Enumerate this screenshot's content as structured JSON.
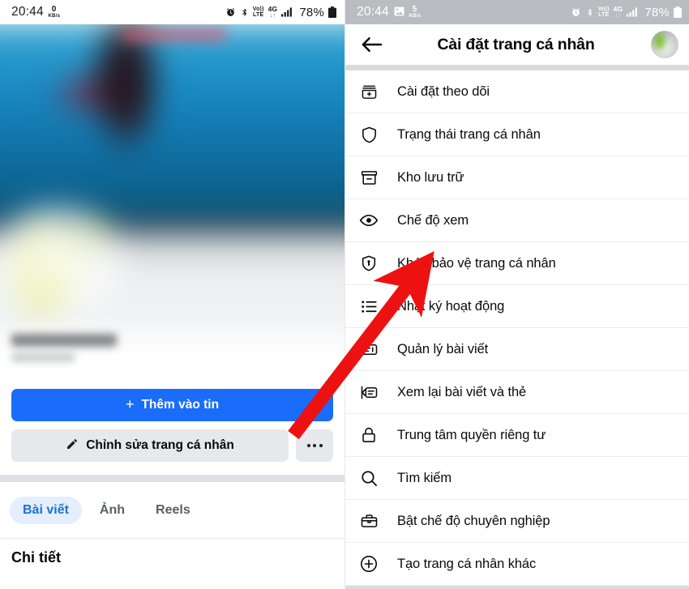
{
  "left_panel": {
    "statusbar": {
      "time": "20:44",
      "net_speed": "0",
      "net_unit": "KB/s",
      "alarm_icon": "alarm-icon",
      "bluetooth_icon": "bluetooth-icon",
      "volte_top": "Vo))",
      "volte_bottom": "LTE",
      "network_type": "4G",
      "network_arrows": "↓↑",
      "signal_icon": "signal-bars-icon",
      "battery": "78%",
      "battery_icon": "battery-icon"
    },
    "story_button": {
      "label": "Thêm vào tin",
      "plus": "+",
      "color": "#1a6dfa"
    },
    "edit_profile_button": {
      "label": "Chỉnh sửa trang cá nhân",
      "icon": "pencil-icon",
      "color": "#e6e8ec"
    },
    "more_button": {
      "icon": "ellipsis-icon"
    },
    "tabs": [
      {
        "label": "Bài viết",
        "active": true
      },
      {
        "label": "Ảnh",
        "active": false
      },
      {
        "label": "Reels",
        "active": false
      }
    ],
    "detail_heading": "Chi tiết",
    "active_tab_color": "#1a73d4"
  },
  "right_panel": {
    "statusbar": {
      "time": "20:44",
      "image_icon": "image-icon",
      "net_speed": "5",
      "net_unit": "KB/s",
      "alarm_icon": "alarm-icon",
      "bluetooth_icon": "bluetooth-icon",
      "volte_top": "Vo))",
      "volte_bottom": "LTE",
      "network_type": "4G",
      "network_arrows": "↓↑",
      "signal_icon": "signal-bars-icon",
      "battery": "78%",
      "battery_icon": "battery-icon"
    },
    "header": {
      "back_icon": "back-arrow-icon",
      "title": "Cài đặt trang cá nhân",
      "avatar": "profile-avatar"
    },
    "menu_items": [
      {
        "label": "Cài đặt theo dõi",
        "icon": "follow-settings-icon"
      },
      {
        "label": "Trạng thái trang cá nhân",
        "icon": "shield-icon"
      },
      {
        "label": "Kho lưu trữ",
        "icon": "archive-icon"
      },
      {
        "label": "Chế độ xem",
        "icon": "eye-icon"
      },
      {
        "label": "Khóa bảo vệ trang cá nhân",
        "icon": "shield-lock-icon"
      },
      {
        "label": "Nhật ký hoạt động",
        "icon": "activity-log-icon"
      },
      {
        "label": "Quản lý bài viết",
        "icon": "manage-posts-icon"
      },
      {
        "label": "Xem lại bài viết và thẻ",
        "icon": "review-posts-icon"
      },
      {
        "label": "Trung tâm quyền riêng tư",
        "icon": "padlock-icon"
      },
      {
        "label": "Tìm kiếm",
        "icon": "search-icon"
      },
      {
        "label": "Bật chế độ chuyên nghiệp",
        "icon": "briefcase-icon"
      },
      {
        "label": "Tạo trang cá nhân khác",
        "icon": "plus-circle-icon"
      }
    ]
  },
  "annotation": {
    "arrow_color": "#ee1111",
    "points_to": "Khóa bảo vệ trang cá nhân",
    "starts_at": "more-button"
  }
}
